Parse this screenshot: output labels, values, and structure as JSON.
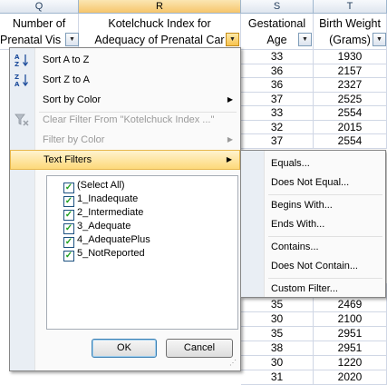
{
  "columns": [
    {
      "letter": "Q",
      "line1": "Number of",
      "line2": "Prenatal Vis"
    },
    {
      "letter": "R",
      "line1": "Kotelchuck Index for",
      "line2": "Adequacy of Prenatal Car"
    },
    {
      "letter": "S",
      "line1": "Gestational",
      "line2": "Age"
    },
    {
      "letter": "T",
      "line1": "Birth Weight",
      "line2": "(Grams)"
    }
  ],
  "rows_top": [
    {
      "s": "33",
      "t": "1930"
    },
    {
      "s": "36",
      "t": "2157"
    },
    {
      "s": "36",
      "t": "2327"
    },
    {
      "s": "37",
      "t": "2525"
    },
    {
      "s": "33",
      "t": "2554"
    },
    {
      "s": "32",
      "t": "2015"
    },
    {
      "s": "37",
      "t": "2554"
    }
  ],
  "rows_bottom": [
    {
      "s": "35",
      "t": "2469"
    },
    {
      "s": "30",
      "t": "2100"
    },
    {
      "s": "35",
      "t": "2951"
    },
    {
      "s": "38",
      "t": "2951"
    },
    {
      "s": "30",
      "t": "1220"
    },
    {
      "s": "31",
      "t": "2020"
    }
  ],
  "menu": {
    "sort_az": "Sort A to Z",
    "sort_za": "Sort Z to A",
    "sort_by_color": "Sort by Color",
    "clear_filter": "Clear Filter From \"Kotelchuck Index ...\"",
    "filter_by_color": "Filter by Color",
    "text_filters": "Text Filters",
    "items": [
      "(Select All)",
      "1_Inadequate",
      "2_Intermediate",
      "3_Adequate",
      "4_AdequatePlus",
      "5_NotReported"
    ],
    "ok": "OK",
    "cancel": "Cancel"
  },
  "submenu": {
    "equals": "Equals...",
    "not_equal": "Does Not Equal...",
    "begins_with": "Begins With...",
    "ends_with": "Ends With...",
    "contains": "Contains...",
    "not_contain": "Does Not Contain...",
    "custom": "Custom Filter..."
  },
  "icons": {
    "sort_az": "sort-ascending-icon",
    "sort_za": "sort-descending-icon",
    "clear_filter": "clear-filter-icon",
    "dropdown": "dropdown-arrow-icon",
    "submenu": "submenu-arrow-icon"
  }
}
